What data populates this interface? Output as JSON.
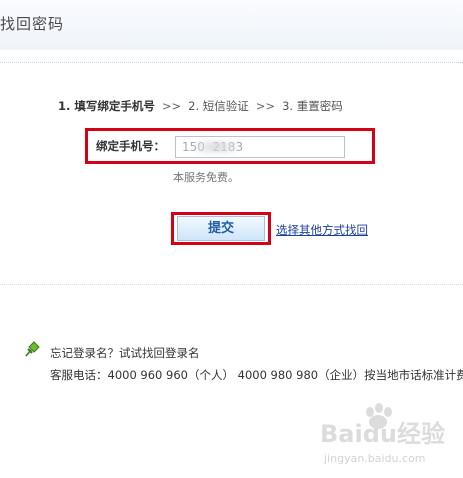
{
  "header": {
    "title": "找回密码"
  },
  "steps": {
    "step1": "1. 填写绑定手机号",
    "step2": "2. 短信验证",
    "step3": "3. 重置密码",
    "separator": ">>"
  },
  "form": {
    "phone_label": "绑定手机号：",
    "phone_value": "150  2183",
    "hint": "本服务免费。",
    "submit_label": "提交",
    "other_method_link": "选择其他方式找回"
  },
  "footer": {
    "forgot_username": "忘记登录名？试试找回登录名",
    "service_phone": "客服电话：4000 960 960（个人） 4000 980 980（企业）按当地市话标准计费"
  },
  "watermark": {
    "brand": "Baidu经验",
    "url": "jingyan.baidu.com"
  },
  "colors": {
    "highlight_border": "#d40015",
    "link": "#1a3fa0",
    "button_text": "#1e5fa8"
  }
}
